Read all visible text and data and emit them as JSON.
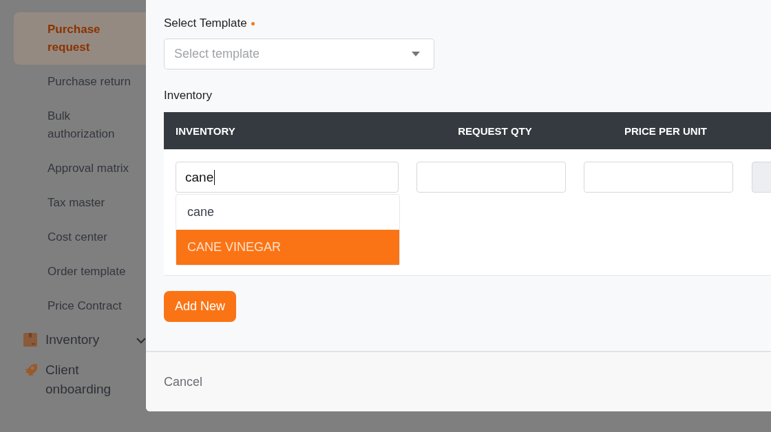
{
  "sidebar": {
    "items": [
      {
        "label": "Purchase request",
        "selected": true
      },
      {
        "label": "Purchase return",
        "selected": false
      },
      {
        "label": "Bulk authorization",
        "selected": false
      },
      {
        "label": "Approval matrix",
        "selected": false
      },
      {
        "label": "Tax master",
        "selected": false
      },
      {
        "label": "Cost center",
        "selected": false
      },
      {
        "label": "Order template",
        "selected": false
      },
      {
        "label": "Price Contract",
        "selected": false
      }
    ],
    "sections": [
      {
        "label": "Inventory",
        "expandable": true
      },
      {
        "label": "Client onboarding",
        "expandable": false
      }
    ]
  },
  "modal": {
    "template": {
      "label": "Select Template",
      "required": true,
      "placeholder": "Select template"
    },
    "inventory_label": "Inventory",
    "table": {
      "columns": [
        "INVENTORY",
        "REQUEST QTY",
        "PRICE PER UNIT"
      ],
      "row": {
        "inventory_value": "cane",
        "suggestions": [
          {
            "label": "cane",
            "selected": false
          },
          {
            "label": "CANE VINEGAR",
            "selected": true
          }
        ]
      }
    },
    "add_button": "Add New",
    "cancel": "Cancel"
  }
}
